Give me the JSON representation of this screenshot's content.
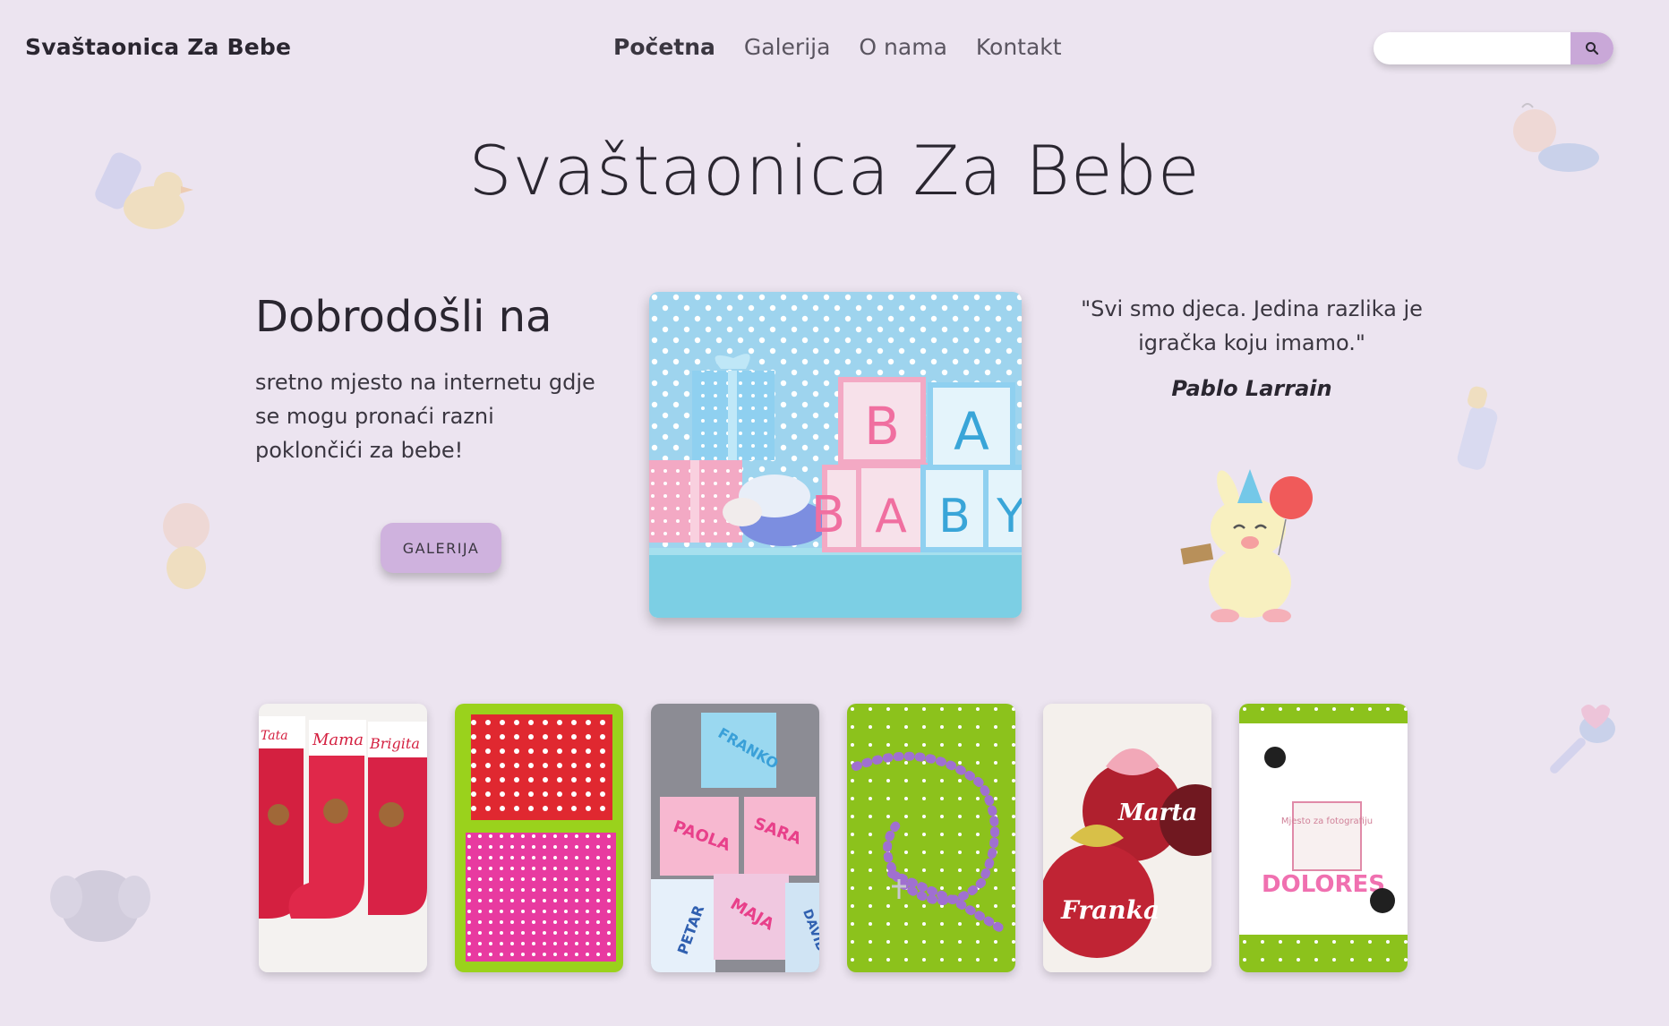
{
  "site": {
    "brand": "Svaštaonica Za Bebe"
  },
  "nav": {
    "items": [
      {
        "label": "Početna",
        "active": true
      },
      {
        "label": "Galerija",
        "active": false
      },
      {
        "label": "O nama",
        "active": false
      },
      {
        "label": "Kontakt",
        "active": false
      }
    ]
  },
  "search": {
    "placeholder": "",
    "icon": "search-icon"
  },
  "hero": {
    "title": "Svaštaonica Za Bebe",
    "welcome_heading": "Dobrodošli na",
    "intro_text": "sretno mjesto na internetu gdje se mogu pronaći razni poklončići za bebe!",
    "button_label": "GALERIJA",
    "image_block_letters": [
      "B",
      "A",
      "B",
      "A",
      "B",
      "Y"
    ]
  },
  "quote": {
    "text": "\"Svi smo djeca. Jedina razlika je igračka koju imamo.\"",
    "author": "Pablo Larrain"
  },
  "gallery": {
    "items": [
      {
        "name": "christmas-stockings",
        "labels": [
          "Tata",
          "Mama",
          "Brigita"
        ]
      },
      {
        "name": "polka-dot-blankets",
        "labels": []
      },
      {
        "name": "name-cubes",
        "labels": [
          "FRANKO",
          "PAOLA",
          "SARA",
          "PETAR",
          "MAJA",
          "DAVID"
        ]
      },
      {
        "name": "purple-rosary",
        "labels": []
      },
      {
        "name": "christmas-ornaments",
        "labels": [
          "Marta",
          "Franka"
        ]
      },
      {
        "name": "photo-frame-minnie",
        "labels": [
          "Mjesto za fotografiju",
          "DOLORES"
        ]
      }
    ]
  },
  "colors": {
    "background": "#ece4f0",
    "accent": "#c9a8d8",
    "button": "#cfb2de",
    "text": "#2a2630"
  }
}
